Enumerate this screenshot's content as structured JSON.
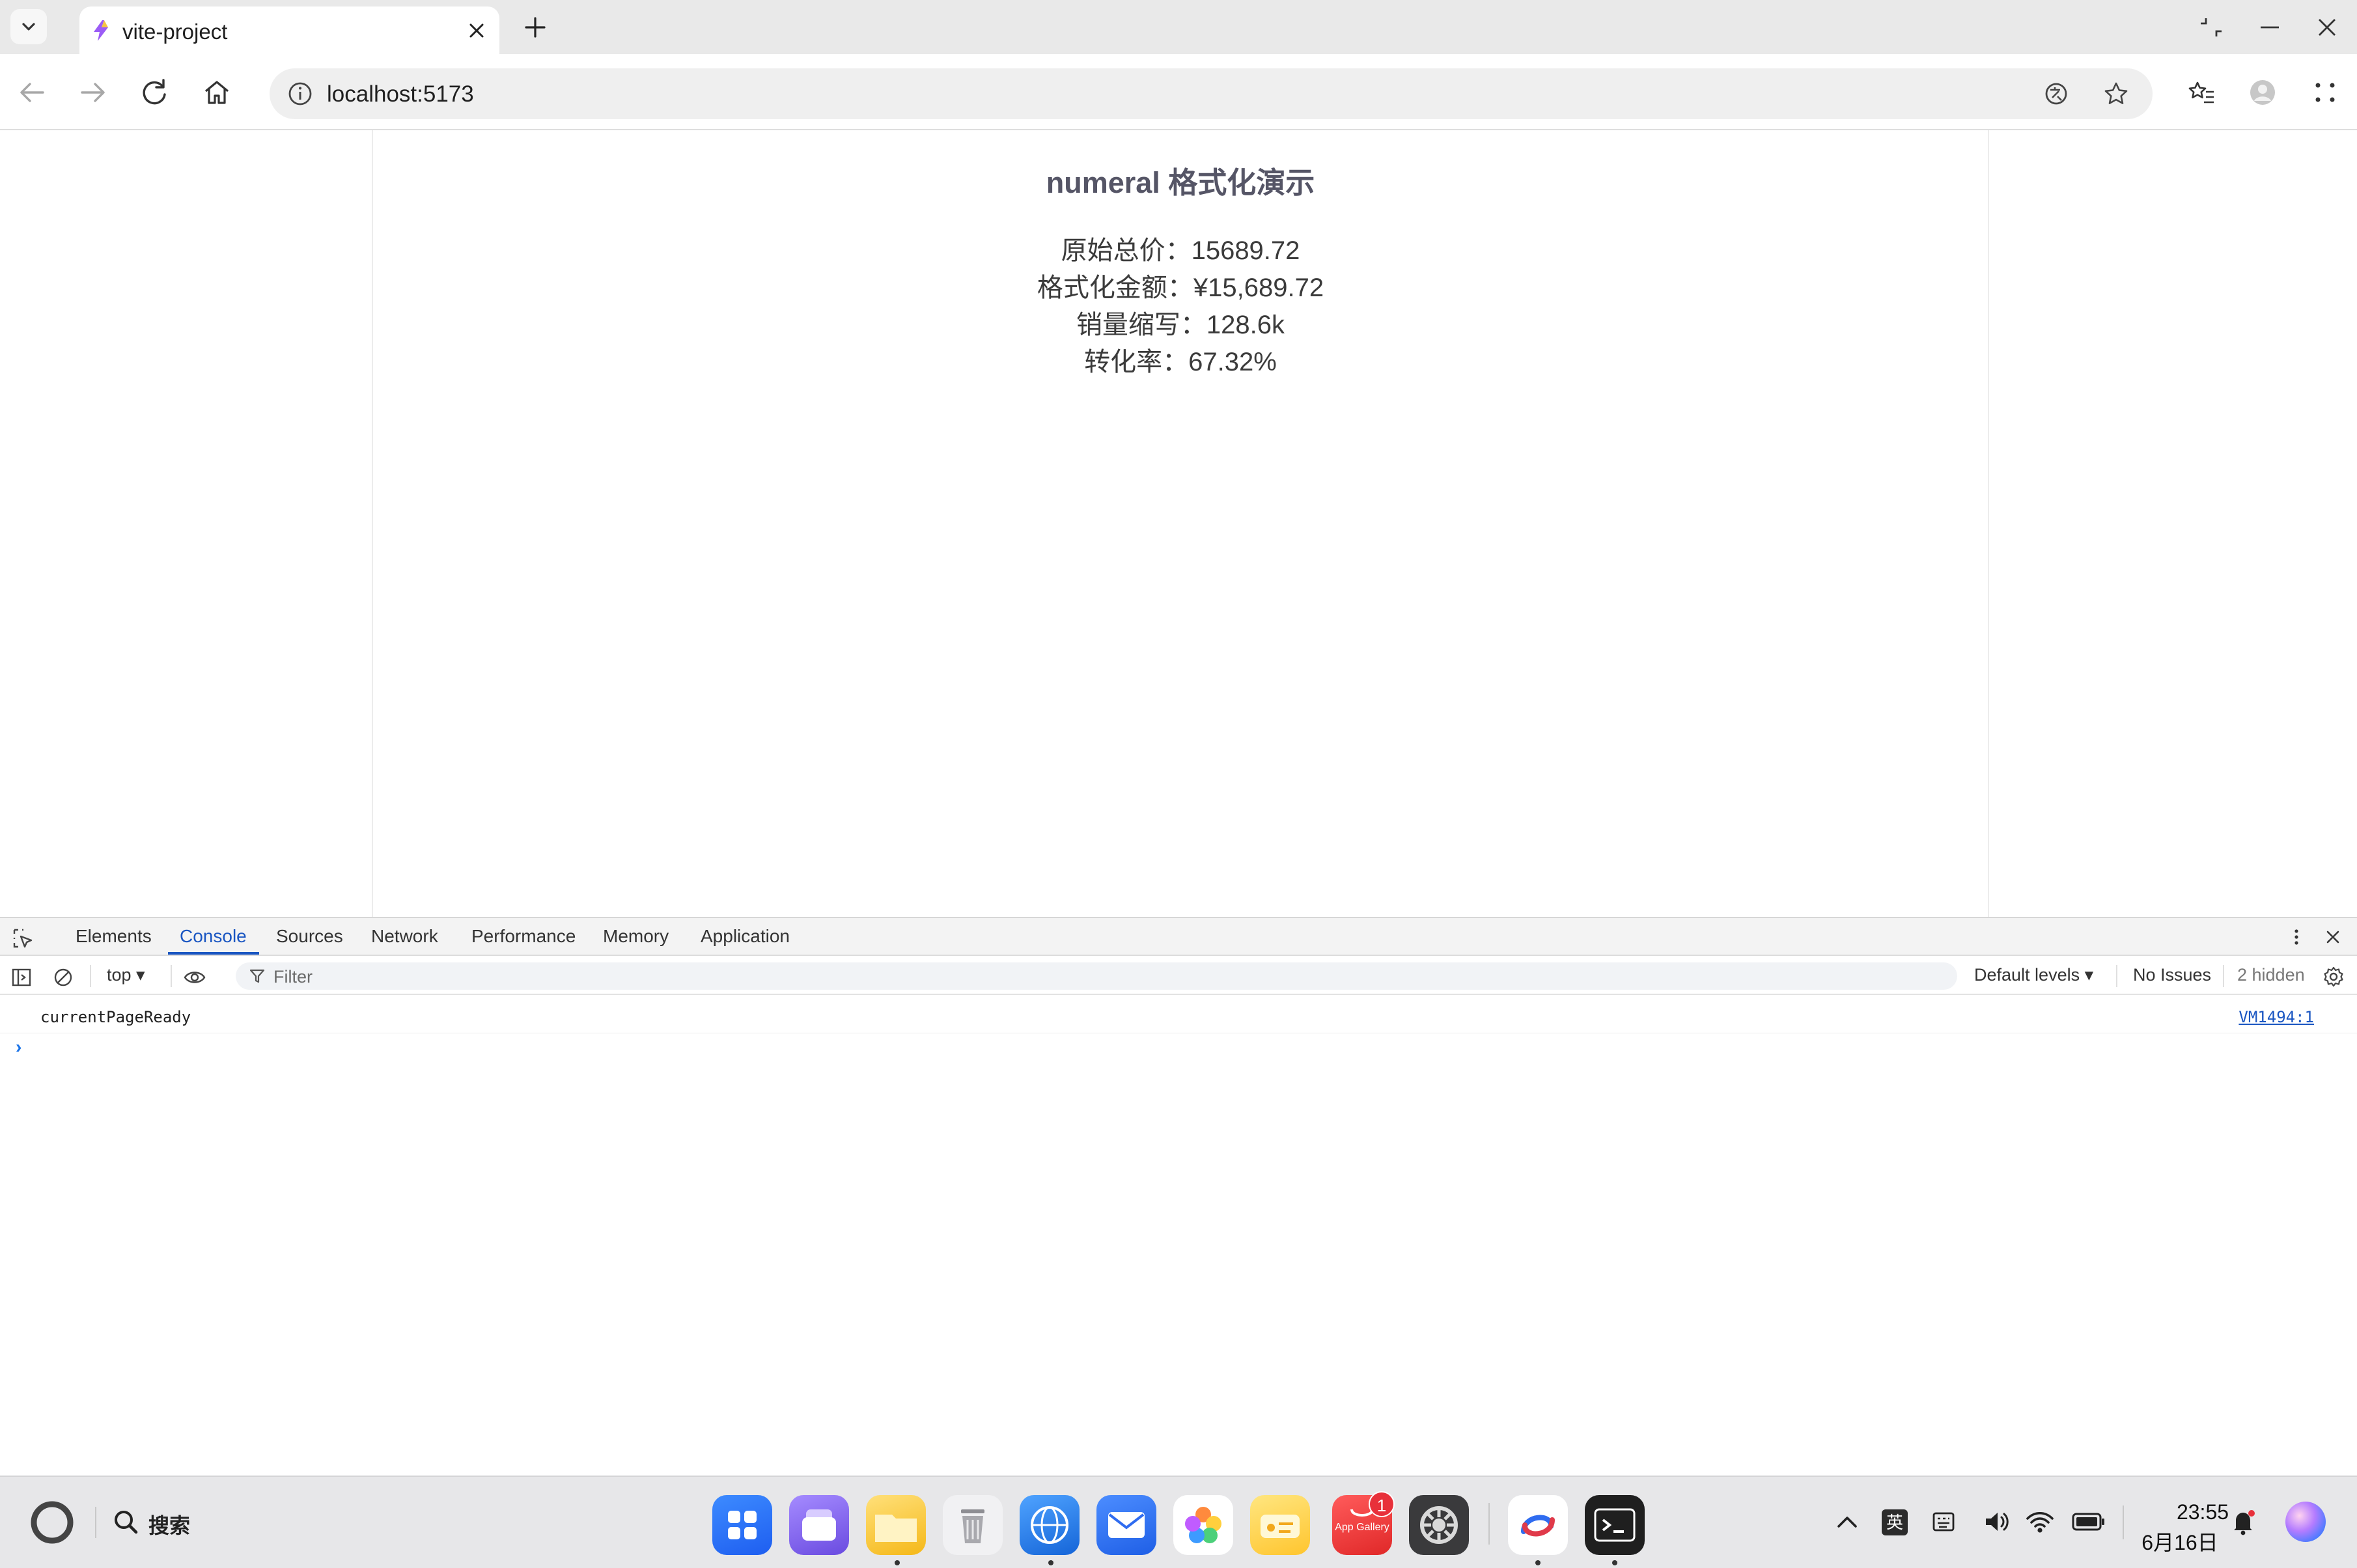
{
  "browser": {
    "tab_title": "vite-project",
    "url": "localhost:5173"
  },
  "page": {
    "title": "numeral 格式化演示",
    "lines": [
      "原始总价：15689.72",
      "格式化金额：¥15,689.72",
      "销量缩写：128.6k",
      "转化率：67.32%"
    ]
  },
  "devtools": {
    "tabs": [
      "Elements",
      "Console",
      "Sources",
      "Network",
      "Performance",
      "Memory",
      "Application"
    ],
    "active_tab": "Console",
    "context": "top",
    "filter_placeholder": "Filter",
    "levels": "Default levels",
    "issues": "No Issues",
    "hidden": "2 hidden",
    "log": {
      "message": "currentPageReady",
      "source": "VM1494:1"
    },
    "prompt_symbol": "›"
  },
  "taskbar": {
    "search_label": "搜索",
    "badge_count": "1",
    "app_gallery_label": "App Gallery",
    "ime": "英",
    "time": "23:55",
    "date": "6月16日"
  },
  "colors": {
    "accent": "#1a56c2",
    "title_text": "#555566",
    "badge": "#e8303a"
  }
}
